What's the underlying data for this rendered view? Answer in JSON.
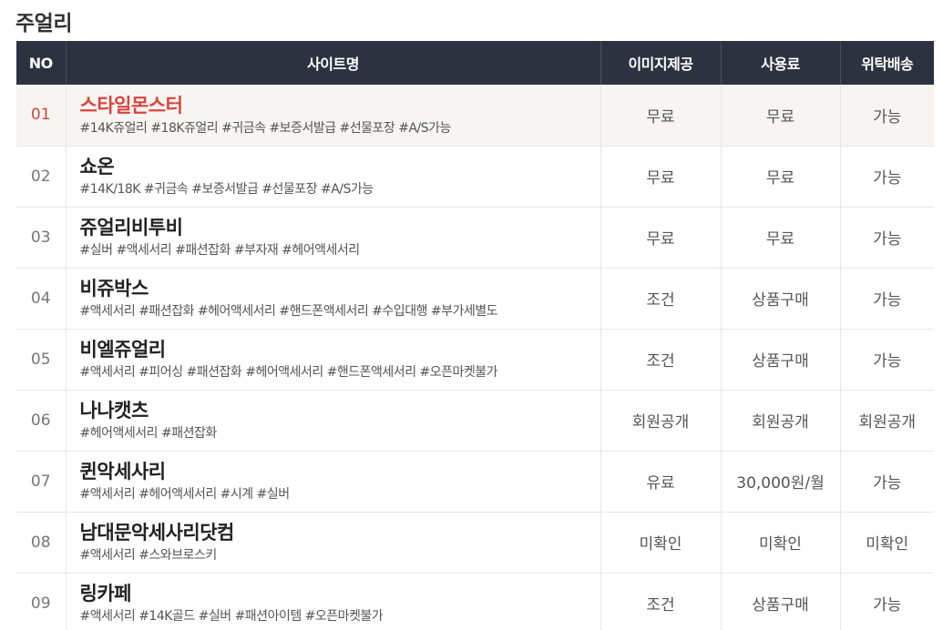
{
  "page_title": "주얼리",
  "table": {
    "headers": {
      "no": "NO",
      "site": "사이트명",
      "image": "이미지제공",
      "fee": "사용료",
      "consign": "위탁배송"
    },
    "rows": [
      {
        "no": "01",
        "name": "스타일몬스터",
        "tags": "#14K쥬얼리 #18K쥬얼리 #귀금속 #보증서발급 #선물포장 #A/S가능",
        "image": "무료",
        "fee": "무료",
        "consign": "가능",
        "highlight": true
      },
      {
        "no": "02",
        "name": "쇼온",
        "tags": "#14K/18K #귀금속 #보증서발급 #선물포장 #A/S가능",
        "image": "무료",
        "fee": "무료",
        "consign": "가능"
      },
      {
        "no": "03",
        "name": "쥬얼리비투비",
        "tags": "#실버 #액세서리 #패션잡화 #부자재 #헤어액세서리",
        "image": "무료",
        "fee": "무료",
        "consign": "가능"
      },
      {
        "no": "04",
        "name": "비쥬박스",
        "tags": "#액세서리 #패션잡화 #헤어액세서리 #핸드폰액세서리 #수입대행 #부가세별도",
        "image": "조건",
        "fee": "상품구매",
        "consign": "가능"
      },
      {
        "no": "05",
        "name": "비엘쥬얼리",
        "tags": "#액세서리 #피어싱 #패션잡화 #헤어액세서리 #핸드폰액세서리 #오픈마켓불가",
        "image": "조건",
        "fee": "상품구매",
        "consign": "가능"
      },
      {
        "no": "06",
        "name": "나나캣츠",
        "tags": "#헤어액세서리 #패션잡화",
        "image": "회원공개",
        "fee": "회원공개",
        "consign": "회원공개"
      },
      {
        "no": "07",
        "name": "퀸악세사리",
        "tags": "#액세서리 #헤어액세서리 #시계 #실버",
        "image": "유료",
        "fee": "30,000원/월",
        "consign": "가능"
      },
      {
        "no": "08",
        "name": "남대문악세사리닷컴",
        "tags": "#액세서리 #스와브로스키",
        "image": "미확인",
        "fee": "미확인",
        "consign": "미확인"
      },
      {
        "no": "09",
        "name": "링카페",
        "tags": "#액세서리 #14K골드 #실버 #패션아이템 #오픈마켓불가",
        "image": "조건",
        "fee": "상품구매",
        "consign": "가능"
      }
    ]
  }
}
